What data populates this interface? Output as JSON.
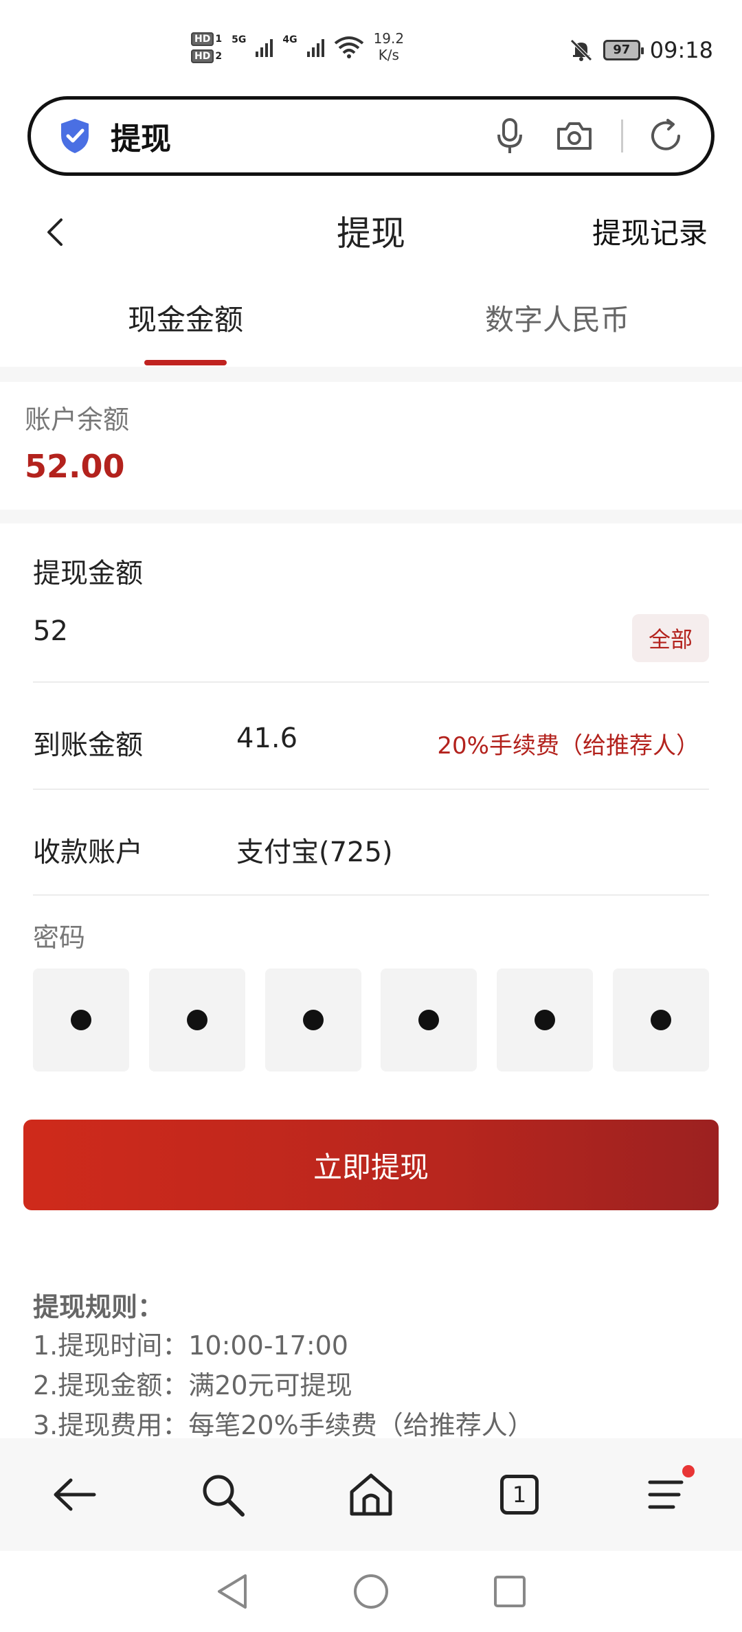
{
  "status_bar": {
    "hd1": "HD",
    "hd1_sub": "1",
    "hd2": "HD",
    "hd2_sub": "2",
    "net1": "5G",
    "net2": "4G",
    "speed_value": "19.2",
    "speed_unit": "K/s",
    "battery": "97",
    "time": "09:18"
  },
  "search": {
    "query": "提现",
    "icons": [
      "shield-check-icon",
      "microphone-icon",
      "camera-icon",
      "refresh-icon"
    ]
  },
  "header": {
    "title": "提现",
    "record_link": "提现记录"
  },
  "tabs": [
    {
      "label": "现金金额",
      "active": true
    },
    {
      "label": "数字人民币",
      "active": false
    }
  ],
  "balance": {
    "label": "账户余额",
    "value": "52.00"
  },
  "form": {
    "amount_label": "提现金额",
    "amount_value": "52",
    "all_button": "全部",
    "received_label": "到账金额",
    "received_value": "41.6",
    "fee_note": "20%手续费（给推荐人）",
    "account_label": "收款账户",
    "account_value": "支付宝(725)",
    "password_label": "密码",
    "pin_length": 6
  },
  "submit_label": "立即提现",
  "rules": {
    "title": "提现规则：",
    "lines": [
      "1.提现时间：10:00-17:00",
      "2.提现金额：满20元可提现",
      "3.提现费用：每笔20%手续费（给推荐人）"
    ]
  },
  "toolbar": {
    "tab_count": "1",
    "icons": [
      "back-arrow-icon",
      "search-icon",
      "home-icon",
      "tabs-icon",
      "menu-icon"
    ]
  },
  "colors": {
    "accent": "#b3221d",
    "button_start": "#cf2a1b",
    "button_end": "#9c2120",
    "notification_dot": "#e83535"
  }
}
